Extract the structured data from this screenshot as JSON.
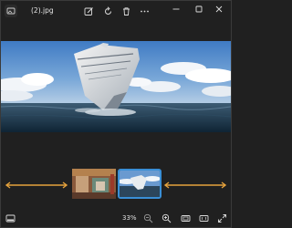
{
  "titlebar": {
    "filename": "(2).jpg",
    "icons": [
      "edit-icon",
      "rotate-icon",
      "delete-icon",
      "more-icon"
    ]
  },
  "window_controls": [
    "minimize",
    "maximize",
    "close"
  ],
  "statusbar": {
    "zoom_level": "33%",
    "icons": [
      "filmstrip-toggle-icon",
      "zoom-out-icon",
      "zoom-in-icon",
      "fit-icon",
      "actual-size-icon",
      "fullscreen-icon"
    ]
  },
  "filmstrip": {
    "thumbnails": [
      {
        "name": "thumbnail-playground",
        "active": false
      },
      {
        "name": "thumbnail-ship",
        "active": true
      }
    ]
  },
  "colors": {
    "accent": "#3a8fd6",
    "arrow": "#e6a23c",
    "background": "#202020"
  }
}
